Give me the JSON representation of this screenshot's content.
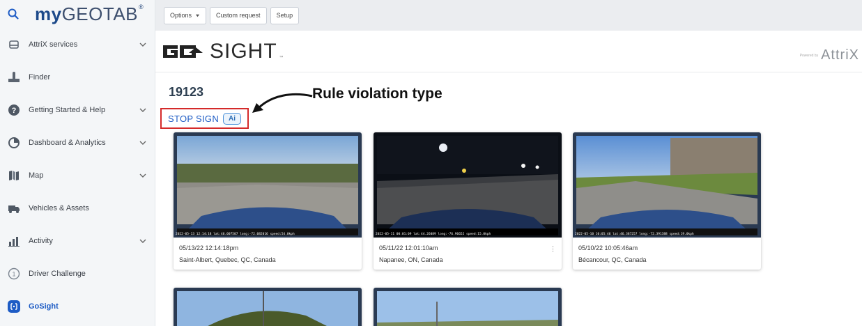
{
  "brand": {
    "logo_bold": "my",
    "logo_rest": "GEOTAB",
    "mark": "®"
  },
  "sidebar": {
    "items": [
      {
        "label": "AttriX services",
        "icon": "attrix-icon",
        "expandable": true
      },
      {
        "label": "Finder",
        "icon": "finder-icon",
        "expandable": false
      },
      {
        "label": "Getting Started & Help",
        "icon": "help-icon",
        "expandable": true
      },
      {
        "label": "Dashboard & Analytics",
        "icon": "dashboard-icon",
        "expandable": true
      },
      {
        "label": "Map",
        "icon": "map-icon",
        "expandable": true
      },
      {
        "label": "Vehicles & Assets",
        "icon": "vehicle-icon",
        "expandable": false
      },
      {
        "label": "Activity",
        "icon": "activity-icon",
        "expandable": true
      },
      {
        "label": "Driver Challenge",
        "icon": "driver-challenge-icon",
        "expandable": false
      },
      {
        "label": "GoSight",
        "icon": "gosight-icon",
        "expandable": false,
        "active": true
      }
    ]
  },
  "toolbar": {
    "options_label": "Options",
    "custom_request_label": "Custom request",
    "setup_label": "Setup"
  },
  "header": {
    "logo_go": "GO",
    "logo_sight": "SIGHT",
    "logo_tm": "™",
    "partner_powered": "Powered by",
    "partner_name": "AttriX"
  },
  "vehicle": {
    "id": "19123"
  },
  "rule": {
    "label": "STOP SIGN",
    "badge": "Ai"
  },
  "annotation": {
    "text": "Rule violation type"
  },
  "colors": {
    "accent": "#1e5cc5",
    "highlight_border": "#d42a2a",
    "id_text": "#2c3e50"
  },
  "events": [
    {
      "datetime": "05/13/22 12:14:18pm",
      "location": "Saint-Albert, Quebec, QC, Canada",
      "stamp": "2022-05-13 12:14:18  lat:46.007507  long:-72.082016  speed:54.0kph"
    },
    {
      "datetime": "05/11/22 12:01:10am",
      "location": "Napanee, ON, Canada",
      "stamp": "2022-05-11 00:01:09  lat:44.26089  long:-76.96652  speed:15.0kph"
    },
    {
      "datetime": "05/10/22 10:05:46am",
      "location": "Bécancour, QC, Canada",
      "stamp": "2022-05-10 10:05:46  lat:46.387257  long:-72.391388  speed:19.0kph"
    }
  ]
}
